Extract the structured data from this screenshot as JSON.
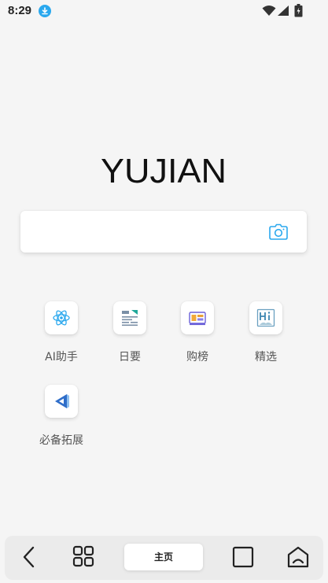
{
  "status_bar": {
    "time": "8:29",
    "icons": [
      "download-icon",
      "wifi-icon",
      "signal-icon",
      "battery-icon"
    ],
    "download_color": "#2aa8ee"
  },
  "logo": {
    "text": "YUJIAN"
  },
  "search": {
    "value": "",
    "placeholder": "",
    "camera_icon": "camera-icon",
    "accent_color": "#2aa8ee"
  },
  "shortcuts": [
    {
      "label": "AI助手",
      "icon": "atom-icon"
    },
    {
      "label": "日要",
      "icon": "news-icon"
    },
    {
      "label": "购榜",
      "icon": "shopping-icon"
    },
    {
      "label": "精选",
      "icon": "hi-icon"
    },
    {
      "label": "必备拓展",
      "icon": "extension-icon"
    }
  ],
  "bottom_nav": {
    "back_icon": "back-icon",
    "grid_icon": "grid-icon",
    "home_label": "主页",
    "tabs_icon": "tabs-icon",
    "user_icon": "user-icon"
  }
}
